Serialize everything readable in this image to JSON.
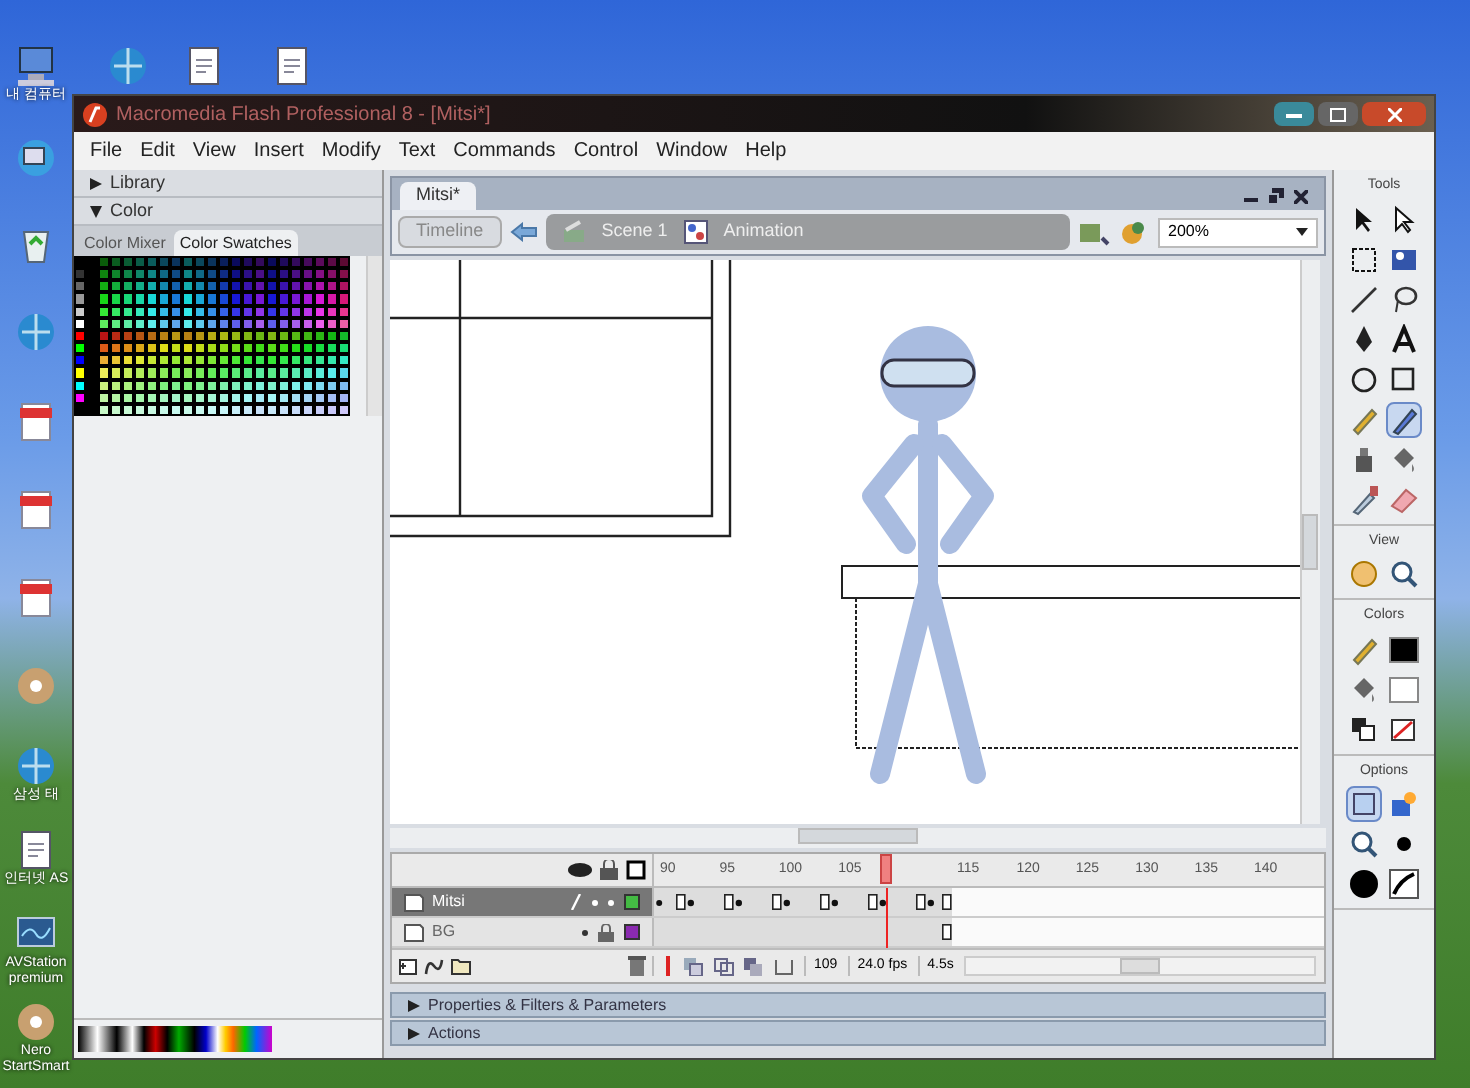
{
  "desktop": {
    "icons": [
      {
        "kind": "computer",
        "label": "내 컴퓨터"
      },
      {
        "kind": "network"
      },
      {
        "kind": "recycle"
      },
      {
        "kind": "globe"
      },
      {
        "kind": "document"
      },
      {
        "kind": "document"
      },
      {
        "kind": "document"
      },
      {
        "kind": "disc"
      },
      {
        "kind": "globe",
        "label": "삼성 태"
      },
      {
        "kind": "page",
        "label": "인터넷 AS"
      },
      {
        "kind": "monitor",
        "label": "AVStation premium"
      },
      {
        "kind": "disc",
        "label": "Nero StartSmart"
      },
      {
        "kind": "globe"
      },
      {
        "kind": "page"
      },
      {
        "kind": "page"
      }
    ]
  },
  "window": {
    "title": "Macromedia Flash Professional 8 - [Mitsi*]",
    "menu": [
      "File",
      "Edit",
      "View",
      "Insert",
      "Modify",
      "Text",
      "Commands",
      "Control",
      "Window",
      "Help"
    ]
  },
  "left_panel": {
    "sections": [
      {
        "title": "Library",
        "expanded": false
      },
      {
        "title": "Color",
        "expanded": true
      }
    ],
    "tabs": [
      {
        "label": "Color Mixer",
        "selected": false
      },
      {
        "label": "Color Swatches",
        "selected": true
      }
    ]
  },
  "document": {
    "tab": "Mitsi*",
    "timeline_button": "Timeline",
    "breadcrumbs": [
      {
        "label": "Scene 1",
        "kind": "scene"
      },
      {
        "label": "Animation",
        "kind": "symbol"
      }
    ],
    "zoom": "200%"
  },
  "timeline": {
    "ruler": [
      "90",
      "95",
      "100",
      "105",
      "115",
      "120",
      "125",
      "130",
      "135",
      "140"
    ],
    "layers": [
      {
        "name": "Mitsi",
        "selected": true,
        "locked": false,
        "color": "#44bb44"
      },
      {
        "name": "BG",
        "selected": false,
        "locked": true,
        "color": "#8a2ab0"
      }
    ],
    "current_frame": "109",
    "frame_rate": "24.0 fps",
    "elapsed": "4.5s"
  },
  "panels": [
    {
      "title": "Properties & Filters & Parameters",
      "expanded": false
    },
    {
      "title": "Actions",
      "expanded": false
    }
  ],
  "toolbox": [
    {
      "title": "Tools",
      "tools": [
        {
          "kind": "arrow",
          "selected": false
        },
        {
          "kind": "subselect",
          "selected": false
        },
        {
          "kind": "transform",
          "selected": false
        },
        {
          "kind": "gradient",
          "selected": false
        },
        {
          "kind": "line",
          "selected": false
        },
        {
          "kind": "lasso",
          "selected": false
        },
        {
          "kind": "pen",
          "selected": false
        },
        {
          "kind": "text",
          "selected": false
        },
        {
          "kind": "oval",
          "selected": false
        },
        {
          "kind": "rect",
          "selected": false
        },
        {
          "kind": "pencil",
          "selected": false
        },
        {
          "kind": "brush",
          "selected": true
        },
        {
          "kind": "bottle",
          "selected": false
        },
        {
          "kind": "bucket",
          "selected": false
        },
        {
          "kind": "dropper",
          "selected": false
        },
        {
          "kind": "eraser",
          "selected": false
        }
      ]
    },
    {
      "title": "View",
      "tools": [
        {
          "kind": "hand",
          "selected": false
        },
        {
          "kind": "zoom",
          "selected": false
        }
      ]
    },
    {
      "title": "Colors",
      "tools": [
        {
          "kind": "pencil",
          "selected": false
        },
        {
          "kind": "stroke",
          "selected": false
        },
        {
          "kind": "bucket",
          "selected": false
        },
        {
          "kind": "fill",
          "selected": false
        },
        {
          "kind": "swatch",
          "selected": false
        },
        {
          "kind": "swap",
          "selected": false
        }
      ]
    },
    {
      "title": "Options",
      "tools": [
        {
          "kind": "object",
          "selected": true
        },
        {
          "kind": "lockfill",
          "selected": false
        },
        {
          "kind": "zoom",
          "selected": false
        },
        {
          "kind": "dot",
          "selected": false
        },
        {
          "kind": "bigdot",
          "selected": false
        },
        {
          "kind": "brushmode",
          "selected": false
        }
      ]
    }
  ]
}
